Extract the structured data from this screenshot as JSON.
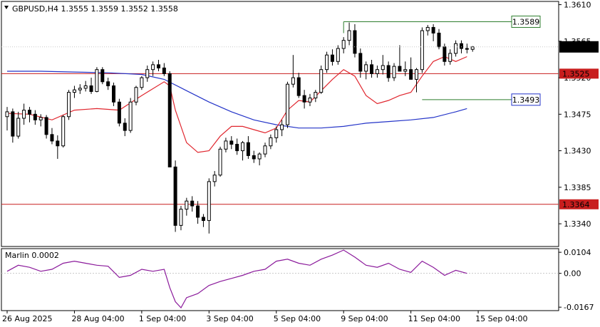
{
  "colors": {
    "bg": "#ffffff",
    "frame": "#000000",
    "grid": "#c8c8c8",
    "bull": "#ffffff",
    "bear": "#000000",
    "wick": "#000000",
    "ma_fast": "#e0262e",
    "ma_slow": "#2333c8",
    "hline": "#c81e1e",
    "box_green": "#2e7d2e",
    "box_blue": "#2333c8",
    "osc": "#8b1a9b",
    "price_bg": "#000000"
  },
  "chart_data": {
    "type": "candlestick",
    "title": "GBPUSD,H4  1.3555 1.3559 1.3552 1.3558",
    "symbol": "GBPUSD,H4",
    "ohlc_header": [
      "1.3555",
      "1.3559",
      "1.3552",
      "1.3558"
    ],
    "y_ticks": [
      "1.3610",
      "1.3565",
      "1.3520",
      "1.3475",
      "1.3430",
      "1.3385",
      "1.3340"
    ],
    "ylim": [
      1.3312,
      1.3614
    ],
    "x_ticks": [
      {
        "label": "26 Aug 2025",
        "index": 0
      },
      {
        "label": "28 Aug 04:00",
        "index": 12
      },
      {
        "label": "1 Sep 04:00",
        "index": 24
      },
      {
        "label": "3 Sep 04:00",
        "index": 36
      },
      {
        "label": "5 Sep 04:00",
        "index": 48
      },
      {
        "label": "9 Sep 04:00",
        "index": 60
      },
      {
        "label": "11 Sep 04:00",
        "index": 72
      },
      {
        "label": "15 Sep 04:00",
        "index": 84
      }
    ],
    "candles": [
      [
        1.3472,
        1.3484,
        1.3455,
        1.3478
      ],
      [
        1.3478,
        1.3482,
        1.344,
        1.3448
      ],
      [
        1.3448,
        1.3478,
        1.3445,
        1.347
      ],
      [
        1.347,
        1.3488,
        1.3462,
        1.348
      ],
      [
        1.348,
        1.3484,
        1.3465,
        1.3475
      ],
      [
        1.3475,
        1.348,
        1.3462,
        1.3468
      ],
      [
        1.3468,
        1.3475,
        1.346,
        1.3471
      ],
      [
        1.3471,
        1.3474,
        1.3445,
        1.345
      ],
      [
        1.345,
        1.3458,
        1.3438,
        1.3442
      ],
      [
        1.3442,
        1.3449,
        1.342,
        1.3436
      ],
      [
        1.3436,
        1.3474,
        1.3434,
        1.3472
      ],
      [
        1.3472,
        1.3505,
        1.3468,
        1.3502
      ],
      [
        1.3502,
        1.351,
        1.3495,
        1.3505
      ],
      [
        1.3505,
        1.3512,
        1.35,
        1.3507
      ],
      [
        1.3507,
        1.3516,
        1.3503,
        1.351
      ],
      [
        1.351,
        1.352,
        1.35,
        1.3503
      ],
      [
        1.3503,
        1.3533,
        1.3502,
        1.353
      ],
      [
        1.353,
        1.3533,
        1.3512,
        1.3515
      ],
      [
        1.3515,
        1.352,
        1.3505,
        1.351
      ],
      [
        1.351,
        1.3514,
        1.3485,
        1.349
      ],
      [
        1.349,
        1.3494,
        1.346,
        1.3464
      ],
      [
        1.3464,
        1.347,
        1.3448,
        1.3455
      ],
      [
        1.3455,
        1.3495,
        1.3452,
        1.349
      ],
      [
        1.349,
        1.351,
        1.3486,
        1.3508
      ],
      [
        1.3508,
        1.3522,
        1.3505,
        1.352
      ],
      [
        1.352,
        1.3535,
        1.3515,
        1.353
      ],
      [
        1.353,
        1.354,
        1.3522,
        1.3536
      ],
      [
        1.3536,
        1.3542,
        1.3528,
        1.3532
      ],
      [
        1.3532,
        1.3538,
        1.3522,
        1.3525
      ],
      [
        1.3525,
        1.3528,
        1.349,
        1.341
      ],
      [
        1.341,
        1.3418,
        1.333,
        1.3338
      ],
      [
        1.3338,
        1.3362,
        1.3332,
        1.3358
      ],
      [
        1.3358,
        1.3372,
        1.335,
        1.3368
      ],
      [
        1.3368,
        1.3374,
        1.3355,
        1.3362
      ],
      [
        1.3362,
        1.3368,
        1.334,
        1.3348
      ],
      [
        1.3348,
        1.3352,
        1.3336,
        1.3344
      ],
      [
        1.3344,
        1.3396,
        1.3328,
        1.3392
      ],
      [
        1.3392,
        1.3405,
        1.3386,
        1.34
      ],
      [
        1.34,
        1.3435,
        1.3398,
        1.3432
      ],
      [
        1.3432,
        1.3446,
        1.3428,
        1.3442
      ],
      [
        1.3442,
        1.3448,
        1.3432,
        1.3438
      ],
      [
        1.3438,
        1.3445,
        1.3425,
        1.343
      ],
      [
        1.343,
        1.3442,
        1.3418,
        1.344
      ],
      [
        1.344,
        1.3448,
        1.342,
        1.3424
      ],
      [
        1.3424,
        1.343,
        1.3415,
        1.342
      ],
      [
        1.342,
        1.3428,
        1.3412,
        1.3426
      ],
      [
        1.3426,
        1.344,
        1.3422,
        1.3436
      ],
      [
        1.3436,
        1.345,
        1.3432,
        1.3446
      ],
      [
        1.3446,
        1.346,
        1.344,
        1.3456
      ],
      [
        1.3456,
        1.3468,
        1.3448,
        1.3462
      ],
      [
        1.3462,
        1.3515,
        1.3458,
        1.3512
      ],
      [
        1.3512,
        1.3548,
        1.3508,
        1.352
      ],
      [
        1.352,
        1.3526,
        1.3495,
        1.3498
      ],
      [
        1.3498,
        1.3505,
        1.3482,
        1.349
      ],
      [
        1.349,
        1.35,
        1.3485,
        1.3495
      ],
      [
        1.3495,
        1.3505,
        1.349,
        1.3502
      ],
      [
        1.3502,
        1.3535,
        1.35,
        1.353
      ],
      [
        1.353,
        1.3552,
        1.3526,
        1.3548
      ],
      [
        1.3548,
        1.3555,
        1.3535,
        1.354
      ],
      [
        1.354,
        1.356,
        1.3536,
        1.3556
      ],
      [
        1.3556,
        1.357,
        1.355,
        1.3566
      ],
      [
        1.3566,
        1.3588,
        1.356,
        1.3578
      ],
      [
        1.3578,
        1.3586,
        1.3545,
        1.355
      ],
      [
        1.355,
        1.3556,
        1.352,
        1.3528
      ],
      [
        1.3528,
        1.354,
        1.3518,
        1.3536
      ],
      [
        1.3536,
        1.3542,
        1.352,
        1.3525
      ],
      [
        1.3525,
        1.3535,
        1.352,
        1.353
      ],
      [
        1.353,
        1.3548,
        1.3524,
        1.3535
      ],
      [
        1.3535,
        1.354,
        1.3515,
        1.352
      ],
      [
        1.352,
        1.3538,
        1.3516,
        1.3534
      ],
      [
        1.3534,
        1.356,
        1.353,
        1.3528
      ],
      [
        1.3528,
        1.354,
        1.3522,
        1.353
      ],
      [
        1.353,
        1.3545,
        1.352,
        1.3518
      ],
      [
        1.3518,
        1.3532,
        1.3502,
        1.353
      ],
      [
        1.353,
        1.3582,
        1.3526,
        1.3578
      ],
      [
        1.3578,
        1.3585,
        1.3572,
        1.3582
      ],
      [
        1.3582,
        1.3586,
        1.3565,
        1.3575
      ],
      [
        1.3575,
        1.358,
        1.3555,
        1.3558
      ],
      [
        1.3558,
        1.3562,
        1.3535,
        1.354
      ],
      [
        1.354,
        1.3555,
        1.3536,
        1.355
      ],
      [
        1.355,
        1.3566,
        1.3546,
        1.3562
      ],
      [
        1.3562,
        1.3566,
        1.355,
        1.3556
      ],
      [
        1.3556,
        1.3562,
        1.355,
        1.3555
      ],
      [
        1.3555,
        1.3559,
        1.3552,
        1.3558
      ]
    ],
    "ma_fast": {
      "x": [
        0,
        4,
        8,
        12,
        16,
        20,
        24,
        28,
        29,
        30,
        32,
        34,
        36,
        38,
        40,
        42,
        44,
        46,
        48,
        50,
        52,
        54,
        56,
        58,
        60,
        62,
        64,
        66,
        68,
        70,
        72,
        74,
        76,
        78,
        80,
        82
      ],
      "y": [
        1.3476,
        1.3475,
        1.3468,
        1.348,
        1.3482,
        1.348,
        1.3498,
        1.3515,
        1.351,
        1.348,
        1.344,
        1.3428,
        1.343,
        1.3448,
        1.346,
        1.346,
        1.3456,
        1.3452,
        1.3458,
        1.348,
        1.3492,
        1.349,
        1.3504,
        1.3518,
        1.353,
        1.3522,
        1.3498,
        1.3488,
        1.3492,
        1.3498,
        1.3502,
        1.3522,
        1.354,
        1.3546,
        1.354,
        1.3546
      ]
    },
    "ma_slow": {
      "x": [
        0,
        6,
        12,
        18,
        24,
        28,
        32,
        36,
        40,
        44,
        48,
        52,
        56,
        60,
        64,
        68,
        72,
        76,
        80,
        82
      ],
      "y": [
        1.3528,
        1.3528,
        1.3527,
        1.3526,
        1.3524,
        1.3518,
        1.3504,
        1.349,
        1.3478,
        1.3468,
        1.3462,
        1.3458,
        1.3458,
        1.346,
        1.3464,
        1.3466,
        1.3468,
        1.3471,
        1.3478,
        1.3482
      ]
    },
    "hlines": [
      {
        "value": 1.3525,
        "label": "1.3525"
      },
      {
        "value": 1.3364,
        "label": "1.3364"
      }
    ],
    "range_box": {
      "start_index": 60,
      "end_index": 85,
      "top": 1.3589,
      "top_label": "1.3589",
      "bottom": 1.3493,
      "bottom_label": "1.3493"
    },
    "current_price": {
      "value": 1.3558,
      "label": "1.3558"
    },
    "oscillator": {
      "name": "Marlin 0.0002",
      "y_ticks": [
        "0.0104",
        "0.00",
        "-0.0167"
      ],
      "ylim": [
        -0.0184,
        0.0122
      ],
      "x": [
        0,
        2,
        4,
        6,
        8,
        10,
        12,
        14,
        16,
        18,
        20,
        22,
        24,
        26,
        28,
        29,
        30,
        31,
        32,
        34,
        36,
        38,
        40,
        42,
        44,
        46,
        48,
        50,
        52,
        54,
        56,
        58,
        60,
        62,
        64,
        66,
        68,
        70,
        72,
        74,
        76,
        78,
        80,
        82
      ],
      "y": [
        0.001,
        0.004,
        0.003,
        0.001,
        0.002,
        0.005,
        0.006,
        0.005,
        0.004,
        0.0035,
        -0.002,
        -0.001,
        0.002,
        0.001,
        0.002,
        -0.007,
        -0.014,
        -0.017,
        -0.012,
        -0.01,
        -0.006,
        -0.004,
        -0.0025,
        -0.001,
        0.001,
        0.002,
        0.006,
        0.007,
        0.005,
        0.004,
        0.007,
        0.009,
        0.0115,
        0.008,
        0.004,
        0.003,
        0.005,
        0.002,
        0.0005,
        0.006,
        0.003,
        -0.001,
        0.0015,
        0.0
      ]
    }
  }
}
